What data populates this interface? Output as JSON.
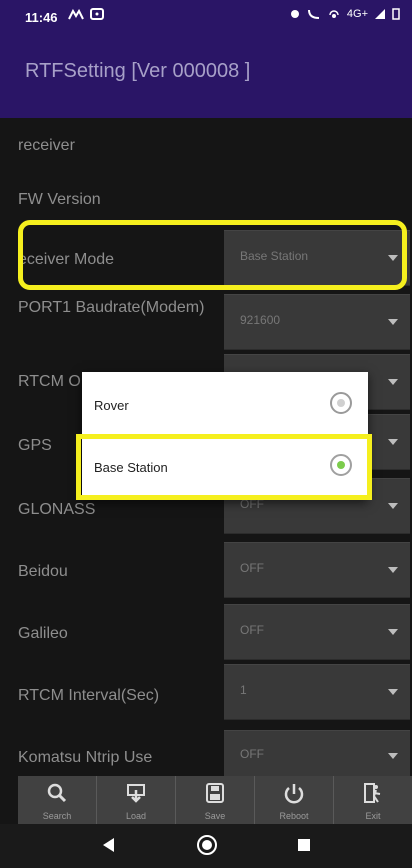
{
  "status": {
    "time": "11:46",
    "net_label": "4G+"
  },
  "app": {
    "title": "RTFSetting [Ver 000008 ]"
  },
  "fields": [
    {
      "label": "receiver"
    },
    {
      "label": "FW Version"
    },
    {
      "label": "eceiver Mode",
      "value": "Base Station"
    },
    {
      "label": "PORT1 Baudrate(Modem)",
      "value": "921600"
    },
    {
      "label": "RTCM O",
      "value": ""
    },
    {
      "label": "GPS",
      "value": ""
    },
    {
      "label": "GLONASS",
      "value": "OFF"
    },
    {
      "label": "Beidou",
      "value": "OFF"
    },
    {
      "label": "Galileo",
      "value": "OFF"
    },
    {
      "label": "RTCM Interval(Sec)",
      "value": "1"
    },
    {
      "label": "Komatsu Ntrip Use",
      "value": "OFF"
    }
  ],
  "dialog": {
    "options": [
      {
        "label": "Rover",
        "selected": false
      },
      {
        "label": "Base Station",
        "selected": true
      }
    ]
  },
  "toolbar": {
    "buttons": [
      "Search",
      "Load",
      "Save",
      "Reboot",
      "Exit"
    ]
  },
  "colors": {
    "title_bar": "#2a1566",
    "highlight": "#f5ef1e",
    "radio_selected": "#7ccc4c"
  }
}
